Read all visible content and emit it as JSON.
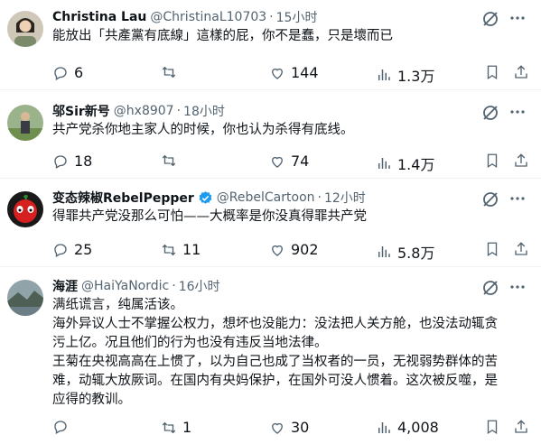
{
  "tweets": [
    {
      "name": "Christina Lau",
      "handle": "@ChristinaL10703",
      "time": "15小时",
      "text": [
        "能放出「共產黨有底線」這樣的屁，你不是蠢，只是壞而已"
      ],
      "reply": "6",
      "retweet": "",
      "like": "144",
      "views": "1.3万",
      "verified": false
    },
    {
      "name": "邬Sir新号",
      "handle": "@hx8907",
      "time": "18小时",
      "text": [
        "共产党杀你地主家人的时候，你也认为杀得有底线。"
      ],
      "reply": "18",
      "retweet": "",
      "like": "74",
      "views": "1.4万",
      "verified": false
    },
    {
      "name": "变态辣椒RebelPepper",
      "handle": "@RebelCartoon",
      "time": "12小时",
      "text": [
        "得罪共产党没那么可怕——大概率是你没真得罪共产党"
      ],
      "reply": "25",
      "retweet": "11",
      "like": "902",
      "views": "5.8万",
      "verified": true
    },
    {
      "name": "海涯",
      "handle": "@HaiYaNordic",
      "time": "16小时",
      "text": [
        "满纸谎言，纯属活该。",
        "海外异议人士不掌握公权力，想坏也没能力：没法把人关方舱，也没法动辄贪",
        "污上亿。况且他们的行为也没有违反当地法律。",
        "王菊在央视高高在上惯了，以为自己也成了当权者的一员，无视弱势群体的苦",
        "难，动辄大放厥词。在国内有央妈保护，在国外可没人惯着。这次被反噬，是",
        "应得的教训。"
      ],
      "reply": "",
      "retweet": "1",
      "like": "30",
      "views": "4,008",
      "verified": false
    }
  ],
  "colors": {
    "text": "#0f1419",
    "secondary": "#536471",
    "verified": "#1d9bf0"
  }
}
